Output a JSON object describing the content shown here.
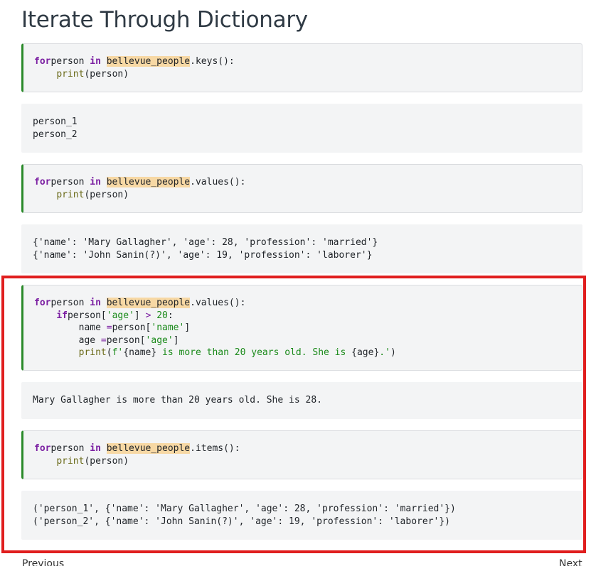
{
  "page": {
    "title": "Iterate Through Dictionary"
  },
  "cells": [
    {
      "kind": "code",
      "lines": [
        [
          [
            "kw",
            "for"
          ],
          [
            "",
            "person "
          ],
          [
            "kw",
            "in"
          ],
          [
            "",
            ""
          ],
          [
            "hl",
            "bellevue_people"
          ],
          [
            "",
            ".keys():"
          ]
        ],
        [
          [
            "",
            "    "
          ],
          [
            "fn",
            "print"
          ],
          [
            "",
            "(person)"
          ]
        ]
      ]
    },
    {
      "kind": "output",
      "lines": [
        [
          [
            "",
            "person_1"
          ]
        ],
        [
          [
            "",
            "person_2"
          ]
        ]
      ]
    },
    {
      "kind": "code",
      "lines": [
        [
          [
            "kw",
            "for"
          ],
          [
            "",
            "person "
          ],
          [
            "kw",
            "in"
          ],
          [
            "",
            ""
          ],
          [
            "hl",
            "bellevue_people"
          ],
          [
            "",
            ".values():"
          ]
        ],
        [
          [
            "",
            "    "
          ],
          [
            "fn",
            "print"
          ],
          [
            "",
            "(person)"
          ]
        ]
      ]
    },
    {
      "kind": "output",
      "lines": [
        [
          [
            "",
            "{'name': 'Mary Gallagher', 'age': 28, 'profession': 'married'}"
          ]
        ],
        [
          [
            "",
            "{'name': 'John Sanin(?)', 'age': 19, 'profession': 'laborer'}"
          ]
        ]
      ]
    },
    {
      "kind": "code",
      "lines": [
        [
          [
            "kw",
            "for"
          ],
          [
            "",
            "person "
          ],
          [
            "kw",
            "in"
          ],
          [
            "",
            ""
          ],
          [
            "hl",
            "bellevue_people"
          ],
          [
            "",
            ".values():"
          ]
        ],
        [
          [
            "",
            "    "
          ],
          [
            "kw",
            "if"
          ],
          [
            "",
            "person["
          ],
          [
            "str",
            "'age'"
          ],
          [
            "",
            "] "
          ],
          [
            "op",
            ">"
          ],
          [
            "",
            ""
          ],
          [
            "num",
            "20"
          ],
          [
            "",
            ":"
          ]
        ],
        [
          [
            "",
            "        name "
          ],
          [
            "op",
            "="
          ],
          [
            "",
            "person["
          ],
          [
            "str",
            "'name'"
          ],
          [
            "",
            "]"
          ]
        ],
        [
          [
            "",
            "        age "
          ],
          [
            "op",
            "="
          ],
          [
            "",
            "person["
          ],
          [
            "str",
            "'age'"
          ],
          [
            "",
            "]"
          ]
        ],
        [
          [
            "",
            "        "
          ],
          [
            "fn",
            "print"
          ],
          [
            "",
            "("
          ],
          [
            "str",
            "f'"
          ],
          [
            "",
            "{name}"
          ],
          [
            "str",
            " is more than 20 years old. She is "
          ],
          [
            "",
            "{age}"
          ],
          [
            "str",
            ".'"
          ],
          [
            "",
            ")"
          ]
        ]
      ]
    },
    {
      "kind": "output",
      "lines": [
        [
          [
            "",
            "Mary Gallagher is more than 20 years old. She is 28."
          ]
        ]
      ]
    },
    {
      "kind": "code",
      "lines": [
        [
          [
            "kw",
            "for"
          ],
          [
            "",
            "person "
          ],
          [
            "kw",
            "in"
          ],
          [
            "",
            ""
          ],
          [
            "hl",
            "bellevue_people"
          ],
          [
            "",
            ".items():"
          ]
        ],
        [
          [
            "",
            "    "
          ],
          [
            "fn",
            "print"
          ],
          [
            "",
            "(person)"
          ]
        ]
      ]
    },
    {
      "kind": "output",
      "lines": [
        [
          [
            "",
            "('person_1', {'name': 'Mary Gallagher', 'age': 28, 'profession': 'married'})"
          ]
        ],
        [
          [
            "",
            "('person_2', {'name': 'John Sanin(?)', 'age': 19, 'profession': 'laborer'})"
          ]
        ]
      ]
    }
  ],
  "nav": {
    "previous_label": "Previous",
    "next_label": "Next"
  },
  "colors": {
    "highlight_box": "#e01e1e",
    "code_border_accent": "#2a8a2a",
    "cell_background": "#f3f4f5",
    "name_highlight": "#f7d8a4"
  }
}
